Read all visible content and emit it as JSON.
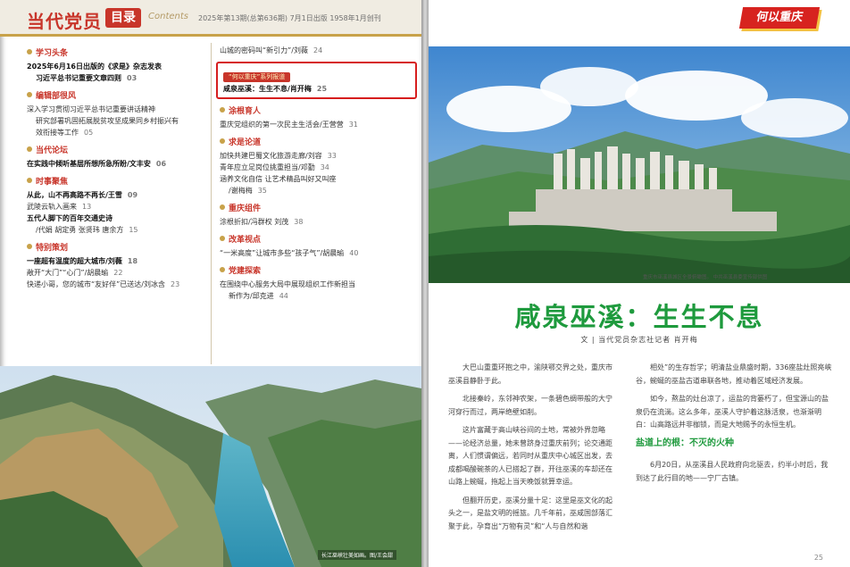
{
  "left_page": {
    "header": {
      "brand": "当代党员",
      "mulu": "目录",
      "contents": "Contents",
      "issue_info": "2025年第13期(总第636期)  7月1日出版  1958年1月创刊"
    },
    "col_a": [
      {
        "title": "学习头条",
        "items": [
          {
            "text": "2025年6月16日出版的《求是》杂志发表",
            "bold": true
          },
          {
            "text": "习近平总书记重要文章四则",
            "page": "03",
            "bold": true,
            "indent": true
          }
        ]
      },
      {
        "title": "编辑部很风",
        "items": [
          {
            "text": "深入学习贯彻习近平总书记重要讲话精神"
          },
          {
            "text": "研究部署巩固拓展脱贫攻坚成果同乡村振兴有",
            "indent": true
          },
          {
            "text": "效衔接等工作",
            "page": "05",
            "indent": true
          }
        ]
      },
      {
        "title": "当代论坛",
        "items": [
          {
            "text": "在实践中倾听基层所想所急所盼",
            "page": "06",
            "author": "文丰安",
            "bold": true
          }
        ]
      },
      {
        "title": "时事聚焦",
        "items": [
          {
            "text": "从此，山不再高路不再长",
            "author": "王雪",
            "page": "09",
            "bold": true
          },
          {
            "text": "武陵云轨入画来",
            "page": "13"
          },
          {
            "text": "五代人脚下的百年交通史诗",
            "bold": true
          },
          {
            "text": "/代娟  胡定勇  张贤玮  唐余方",
            "page": "15",
            "indent": true
          }
        ]
      },
      {
        "title": "特别策划",
        "items": [
          {
            "text": "一座超有温度的超大城市",
            "author": "刘薇",
            "page": "18",
            "bold": true
          },
          {
            "text": "敞开“大门”“心门”",
            "author": "胡晨瑜",
            "page": "22"
          },
          {
            "text": "快递小哥，您的城市“友好伴”已送达",
            "author": "刘冰含",
            "page": "23"
          }
        ]
      }
    ],
    "col_b": [
      {
        "title": "",
        "items": [
          {
            "text": "山城的密码叫“新引力”",
            "author": "刘薇",
            "page": "24"
          }
        ]
      },
      {
        "series_tag": "“何以重庆”系列报道",
        "items": [
          {
            "text": "咸泉巫溪：生生不息",
            "author": "肖开梅",
            "page": "25",
            "bold": true
          }
        ]
      },
      {
        "title": "涂根育人",
        "items": [
          {
            "text": "重庆党组织的第一次民主生活会",
            "author": "王营营",
            "page": "31"
          }
        ]
      },
      {
        "title": "求是论道",
        "items": [
          {
            "text": "加快共建巴蜀文化旅游走廊",
            "author": "刘容",
            "page": "33"
          },
          {
            "text": "青年应立足岗位挑重担当",
            "author": "邓勤",
            "page": "34"
          },
          {
            "text": "涵养文化自信  让艺术精品叫好又叫座"
          },
          {
            "text": "/谢梅梅",
            "page": "35",
            "indent": true
          }
        ]
      },
      {
        "title": "重庆组件",
        "items": [
          {
            "text": "涂根折扣",
            "author": "冯群权  刘茂",
            "page": "38"
          }
        ]
      },
      {
        "title": "改革视点",
        "items": [
          {
            "text": "“一米高度”让城市多些“孩子气”",
            "author": "胡晨瑜",
            "page": "40"
          }
        ]
      },
      {
        "title": "党建探索",
        "items": [
          {
            "text": "在围绕中心服务大局中展现组织工作新担当"
          },
          {
            "text": "新作为",
            "author": "邱克进",
            "page": "44",
            "indent": true
          }
        ]
      }
    ],
    "photo_caption": "长江巫峡壮美如画。图/王会甜"
  },
  "right_page": {
    "tag": "何以重庆",
    "photo_caption": "重庆市巫溪县城区全景俯瞰图。  中共巫溪县委宣传部供图",
    "title": "咸泉巫溪：生生不息",
    "byline": "文 | 当代党员杂志社记者  肖开梅",
    "col_a": [
      "大巴山重重环抱之中，渝陕鄂交界之处，重庆市巫溪县静卧于此。",
      "北接秦岭，东邻神农架，一条碧色绸带般的大宁河穿行而过，两岸绝壁如削。",
      "这片富藏于高山峡谷间的土地，常被外界忽略——论经济总量，她未曾跻身过重庆前列；论交通距离，人们惯谓偏远，若同时从重庆中心城区出发，去成都喝酸碗茶的人已搭起了群，开往巫溪的车却还在山路上蜿蜒，拖起上当天晚饭就算幸运。",
      "但翻开历史，巫溪分量十足：这里是巫文化的起头之一，是盐文明的摇篮。几千年前，巫咸国部落汇聚于此，孕育出“万物有灵”和“人与自然和谐"
    ],
    "col_b": [
      "相处”的生存哲学；明清盐业鼎盛时期，336座盐灶照亮峡谷，蜿蜒的巫盐古道串联各地，推动着区域经济发展。",
      "如今，熬盐的灶台凉了，运盐的背篓朽了，但宝源山的盐泉仍在流淌。这么多年，巫溪人守护着这脉活泉，也渐渐明白：山高路远并非枷锁，而是大地赐予的永恒生机。"
    ],
    "subhead": "盐道上的根：不灭的火种",
    "col_b_after": [
      "6月20日，从巫溪县人民政府向北驱去，约半小时后，我到达了此行目的地——宁厂古镇。"
    ],
    "page_number": "25"
  }
}
